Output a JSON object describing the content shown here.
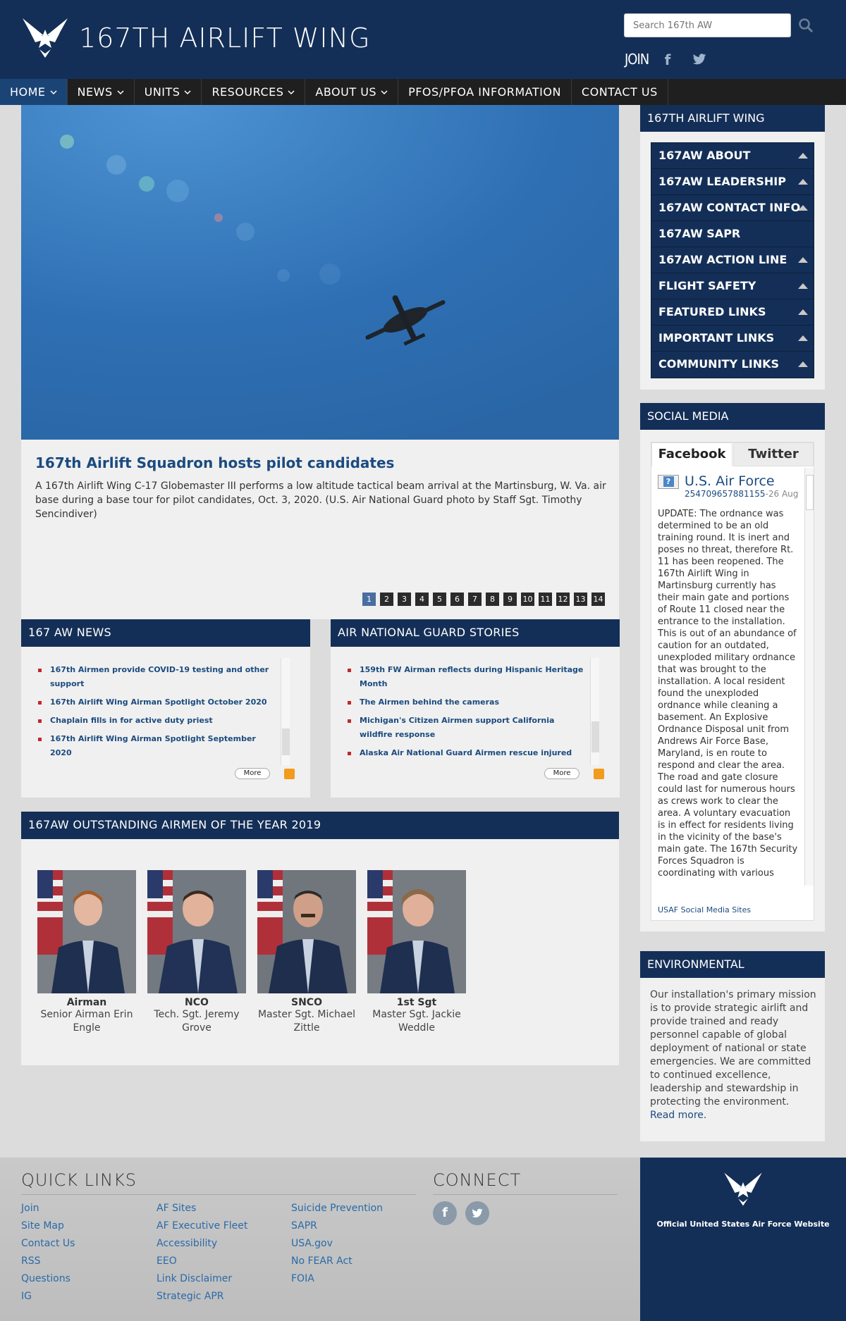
{
  "header": {
    "site_title": "167TH AIRLIFT WING",
    "search_placeholder": "Search 167th AW",
    "join_label": "JOIN",
    "facebook_glyph": "f"
  },
  "nav": {
    "items": [
      {
        "label": "HOME",
        "has_dropdown": true,
        "active": true
      },
      {
        "label": "NEWS",
        "has_dropdown": true
      },
      {
        "label": "UNITS",
        "has_dropdown": true
      },
      {
        "label": "RESOURCES",
        "has_dropdown": true
      },
      {
        "label": "ABOUT US",
        "has_dropdown": true
      },
      {
        "label": "PFOS/PFOA INFORMATION",
        "has_dropdown": false
      },
      {
        "label": "CONTACT US",
        "has_dropdown": false
      }
    ]
  },
  "hero": {
    "title": "167th Airlift Squadron hosts pilot candidates",
    "caption": "A 167th Airlift Wing C-17 Globemaster III performs a low altitude tactical beam arrival at the Martinsburg, W. Va. air base during a base tour for pilot candidates, Oct. 3, 2020. (U.S. Air National Guard photo by Staff Sgt. Timothy Sencindiver)",
    "pages": [
      "1",
      "2",
      "3",
      "4",
      "5",
      "6",
      "7",
      "8",
      "9",
      "10",
      "11",
      "12",
      "13",
      "14"
    ],
    "current_page": "1"
  },
  "news_167": {
    "heading": "167 AW NEWS",
    "items": [
      "167th Airmen provide COVID-19 testing and other support",
      "167th Airlift Wing Airman Spotlight October 2020",
      "Chaplain fills in for active duty priest",
      "167th Airlift Wing Airman Spotlight September 2020"
    ],
    "more_label": "More"
  },
  "news_ang": {
    "heading": "AIR NATIONAL GUARD STORIES",
    "items": [
      "159th FW Airman reflects during Hispanic Heritage Month",
      "The Airmen behind the cameras",
      "Michigan's Citizen Airmen support California wildfire response",
      "Alaska Air National Guard Airmen rescue injured"
    ],
    "more_label": "More"
  },
  "airmen": {
    "heading": "167AW OUTSTANDING AIRMEN OF THE YEAR 2019",
    "people": [
      {
        "rank": "Airman",
        "name": "Senior Airman Erin Engle"
      },
      {
        "rank": "NCO",
        "name": "Tech. Sgt. Jeremy Grove"
      },
      {
        "rank": "SNCO",
        "name": "Master Sgt. Michael Zittle"
      },
      {
        "rank": "1st Sgt",
        "name": "Master Sgt. Jackie Weddle"
      }
    ]
  },
  "sidebar": {
    "wing_heading": "167TH AIRLIFT WING",
    "accordion": [
      "167AW ABOUT",
      "167AW LEADERSHIP",
      "167AW CONTACT INFO",
      "167AW SAPR",
      "167AW ACTION LINE",
      "FLIGHT SAFETY",
      "FEATURED LINKS",
      "IMPORTANT LINKS",
      "COMMUNITY LINKS"
    ],
    "social_heading": "SOCIAL MEDIA",
    "social_tabs": [
      "Facebook",
      "Twitter"
    ],
    "feed": {
      "avatar_glyph": "?",
      "page_name": "U.S. Air Force",
      "post_id": "254709657881155",
      "post_date": "-26 Aug",
      "post_text": "UPDATE: The ordnance was determined to be an old training round. It is inert and poses no threat, therefore Rt. 11 has been reopened. The 167th Airlift Wing in Martinsburg currently has their main gate and portions of Route 11 closed near the entrance to the installation. This is out of an abundance of caution for an outdated, unexploded military ordnance that was brought to the installation. A local resident found the unexploded ordnance while cleaning a basement. An Explosive Ordnance Disposal unit from Andrews Air Force Base, Maryland, is en route to respond and clear the area. The road and gate closure could last for numerous hours as crews work to clear the area. A voluntary evacuation is in effect for residents living in the vicinity of the base's main gate. The 167th Security Forces Squadron is coordinating with various"
    },
    "usaf_social_link": "USAF Social Media Sites",
    "env_heading": "ENVIRONMENTAL",
    "env_text": "Our installation's primary mission is to provide strategic airlift and provide trained and ready personnel capable of global deployment of national or state emergencies. We are committed to continued excellence, leadership and stewardship in protecting the environment.",
    "env_read_more": "Read more."
  },
  "footer": {
    "quick_links_title": "QUICK LINKS",
    "col1": [
      "Join",
      "Site Map",
      "Contact Us",
      "RSS",
      "Questions",
      "IG"
    ],
    "col2": [
      "AF Sites",
      "AF Executive Fleet",
      "Accessibility",
      "EEO",
      "Link Disclaimer",
      "Strategic APR"
    ],
    "col3": [
      "Suicide Prevention",
      "SAPR",
      "USA.gov",
      "No FEAR Act",
      "FOIA"
    ],
    "connect_title": "CONNECT",
    "facebook_glyph": "f",
    "af_caption": "Official United States Air Force Website"
  },
  "colors": {
    "navy": "#142f57",
    "nav_bg": "#1f1f1f",
    "link_blue": "#1b4b7f",
    "bullet_red": "#c0282d",
    "footer_link": "#2a6aa8"
  }
}
